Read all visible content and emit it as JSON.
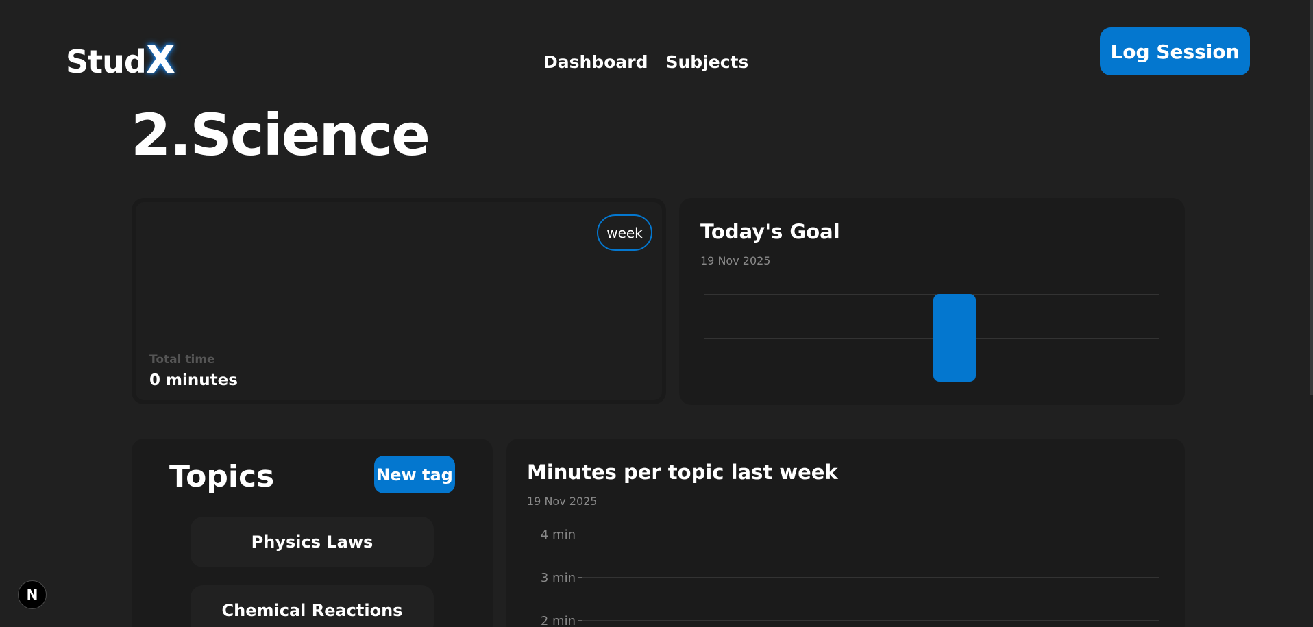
{
  "header": {
    "logo_main": "Stud",
    "logo_accent": "X",
    "nav": [
      "Dashboard",
      "Subjects"
    ],
    "log_button": "Log Session"
  },
  "page": {
    "title": "2.Science"
  },
  "total_card": {
    "range_button": "week",
    "label": "Total time",
    "value": "0 minutes"
  },
  "goal_card": {
    "title": "Today's Goal",
    "date": "19 Nov 2025",
    "chart_data": {
      "type": "bar",
      "categories": [
        ""
      ],
      "values": [
        1
      ],
      "ylim": [
        0,
        1
      ],
      "grid": true,
      "color": "#0477cf"
    }
  },
  "topics_card": {
    "title": "Topics",
    "new_tag_button": "New tag",
    "items": [
      "Physics Laws",
      "Chemical Reactions"
    ]
  },
  "minutes_card": {
    "title": "Minutes per topic last week",
    "date": "19 Nov 2025",
    "chart_data": {
      "type": "bar",
      "ylabel": "",
      "y_ticks": [
        "4 min",
        "3 min",
        "2 min"
      ],
      "ylim": [
        0,
        4
      ],
      "grid": true
    }
  },
  "badge": {
    "label": "N"
  },
  "colors": {
    "accent": "#0477cf",
    "background": "#202020",
    "card": "#1b1b1b"
  }
}
